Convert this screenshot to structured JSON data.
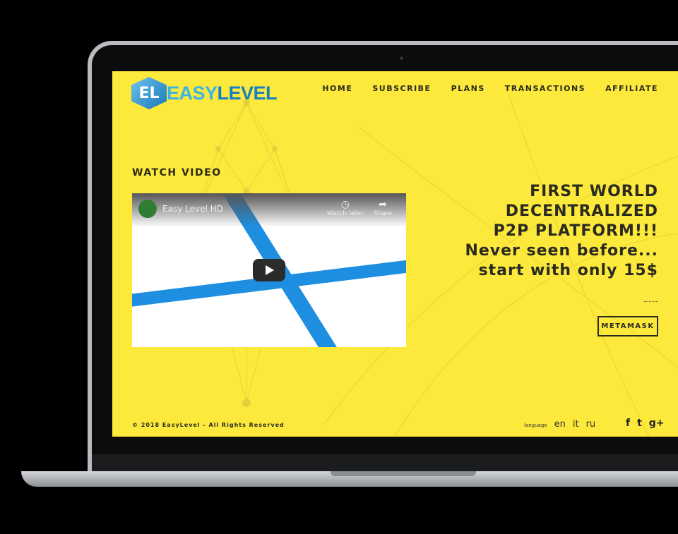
{
  "logo": {
    "mark": "EL",
    "part1": "EASY",
    "part2": "LEVEL"
  },
  "nav": [
    "HOME",
    "SUBSCRIBE",
    "PLANS",
    "TRANSACTIONS",
    "AFFILIATE"
  ],
  "watch_title": "WATCH VIDEO",
  "video": {
    "title": "Easy Level HD",
    "watch_later": "Watch later",
    "share": "Share"
  },
  "hero": [
    "FIRST WORLD",
    "DECENTRALIZED",
    "P2P PLATFORM!!!",
    "Never seen before...",
    "start with only 15$"
  ],
  "button": "METAMASK",
  "footer": {
    "copyright": "© 2018 EasyLevel - All Rights Reserved",
    "language_label": "language",
    "languages": [
      "en",
      "it",
      "ru"
    ],
    "social": [
      "f",
      "t",
      "g+"
    ]
  },
  "colors": {
    "bg": "#fde93c",
    "accent": "#1e8fe0"
  }
}
